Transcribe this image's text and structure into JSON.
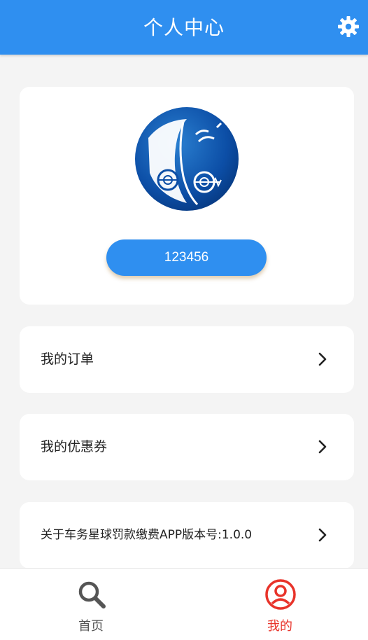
{
  "header": {
    "title": "个人中心",
    "settings_icon": "gear-icon"
  },
  "profile": {
    "avatar_icon": "brand-logo",
    "user_id": "123456"
  },
  "menu": {
    "items": [
      {
        "label": "我的订单",
        "icon": "chevron-right-icon"
      },
      {
        "label": "我的优惠券",
        "icon": "chevron-right-icon"
      },
      {
        "label": "关于车务星球罚款缴费APP版本号:1.0.0",
        "icon": "chevron-right-icon"
      }
    ]
  },
  "tabbar": {
    "tabs": [
      {
        "label": "首页",
        "icon": "search-icon",
        "active": false
      },
      {
        "label": "我的",
        "icon": "user-icon",
        "active": true
      }
    ]
  },
  "colors": {
    "primary": "#2f8ff0",
    "active_tab": "#e8332a",
    "inactive_tab": "#555555",
    "background": "#f4f4f4"
  }
}
